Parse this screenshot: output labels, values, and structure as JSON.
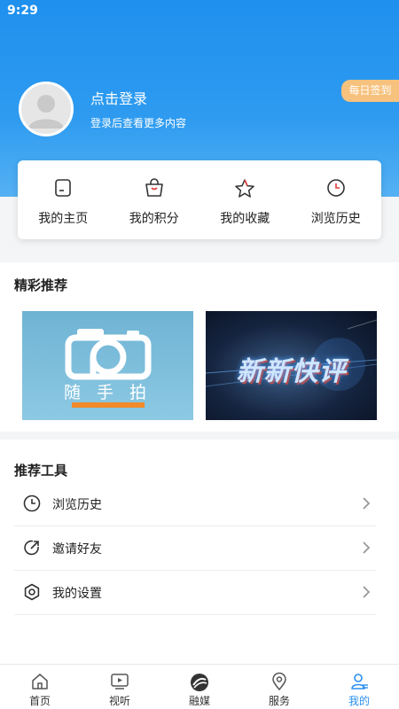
{
  "status_bar": {
    "time": "9:29"
  },
  "profile": {
    "login_title": "点击登录",
    "login_subtitle": "登录后查看更多内容",
    "checkin_label": "每日签到"
  },
  "quick_actions": [
    {
      "label": "我的主页",
      "icon": "homepage-icon"
    },
    {
      "label": "我的积分",
      "icon": "points-bag-icon"
    },
    {
      "label": "我的收藏",
      "icon": "star-icon"
    },
    {
      "label": "浏览历史",
      "icon": "clock-icon"
    }
  ],
  "featured": {
    "title": "精彩推荐",
    "items": [
      {
        "caption": "随 手 拍",
        "icon": "camera-icon"
      },
      {
        "caption": "新新快评",
        "icon": "news-banner"
      }
    ]
  },
  "tools": {
    "title": "推荐工具",
    "items": [
      {
        "label": "浏览历史",
        "icon": "clock-icon"
      },
      {
        "label": "邀请好友",
        "icon": "share-icon"
      },
      {
        "label": "我的设置",
        "icon": "settings-icon"
      }
    ]
  },
  "tabbar": {
    "items": [
      {
        "label": "首页",
        "icon": "home-icon"
      },
      {
        "label": "视听",
        "icon": "tv-icon"
      },
      {
        "label": "融媒",
        "icon": "media-logo-icon"
      },
      {
        "label": "服务",
        "icon": "location-icon"
      },
      {
        "label": "我的",
        "icon": "user-icon",
        "active": true
      }
    ]
  },
  "colors": {
    "header_blue": "#1f90ee",
    "accent_blue": "#2a8ff0",
    "checkin_orange": "#f7c27d"
  }
}
